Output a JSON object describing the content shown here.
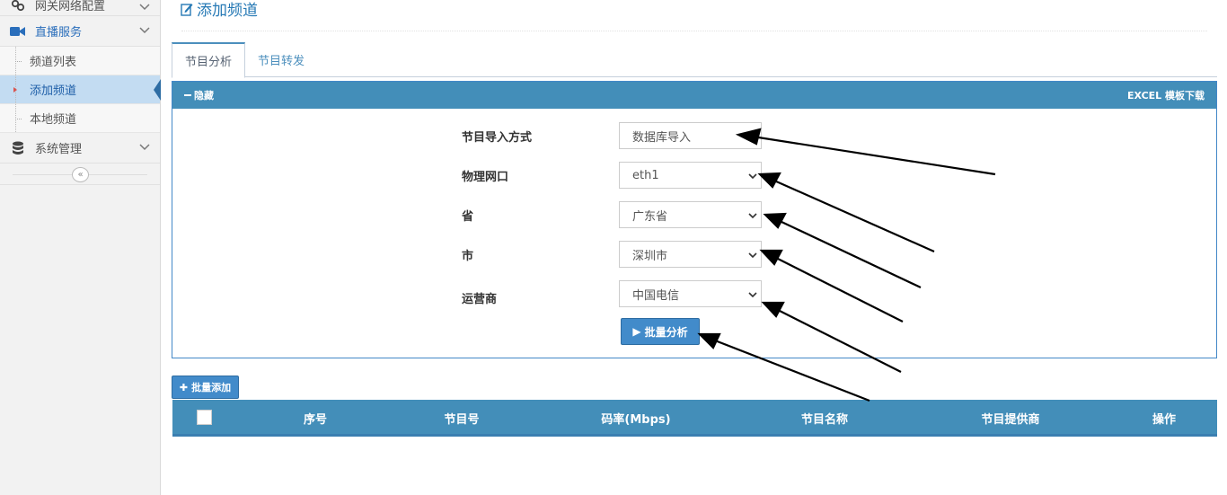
{
  "sidebar": {
    "items": [
      {
        "label": "网关网络配置",
        "icon": "link-icon"
      },
      {
        "label": "直播服务",
        "icon": "video-camera-icon"
      },
      {
        "label": "系统管理",
        "icon": "database-icon"
      }
    ],
    "sub_items": [
      {
        "label": "频道列表"
      },
      {
        "label": "添加频道"
      },
      {
        "label": "本地频道"
      }
    ],
    "collapse_glyph": "«"
  },
  "header": {
    "title": "添加频道",
    "icon": "edit-icon"
  },
  "tabs": [
    {
      "label": "节目分析",
      "active": true
    },
    {
      "label": "节目转发",
      "active": false
    }
  ],
  "panel": {
    "hide_label": "隐藏",
    "download_label": "EXCEL 模板下载",
    "fields": [
      {
        "label": "节目导入方式",
        "value": "数据库导入"
      },
      {
        "label": "物理网口",
        "value": "eth1"
      },
      {
        "label": "省",
        "value": "广东省"
      },
      {
        "label": "市",
        "value": "深圳市"
      },
      {
        "label": "运营商",
        "value": "中国电信"
      }
    ],
    "analyze_button": "批量分析",
    "analyze_glyph": "▶"
  },
  "batch_add": {
    "label": "批量添加",
    "glyph": "✚"
  },
  "table": {
    "columns": [
      "序号",
      "节目号",
      "码率(Mbps)",
      "节目名称",
      "节目提供商",
      "操作"
    ]
  },
  "colors": {
    "accent": "#438eb9",
    "link": "#2679b5",
    "active_nav": "#c3dcf2"
  }
}
